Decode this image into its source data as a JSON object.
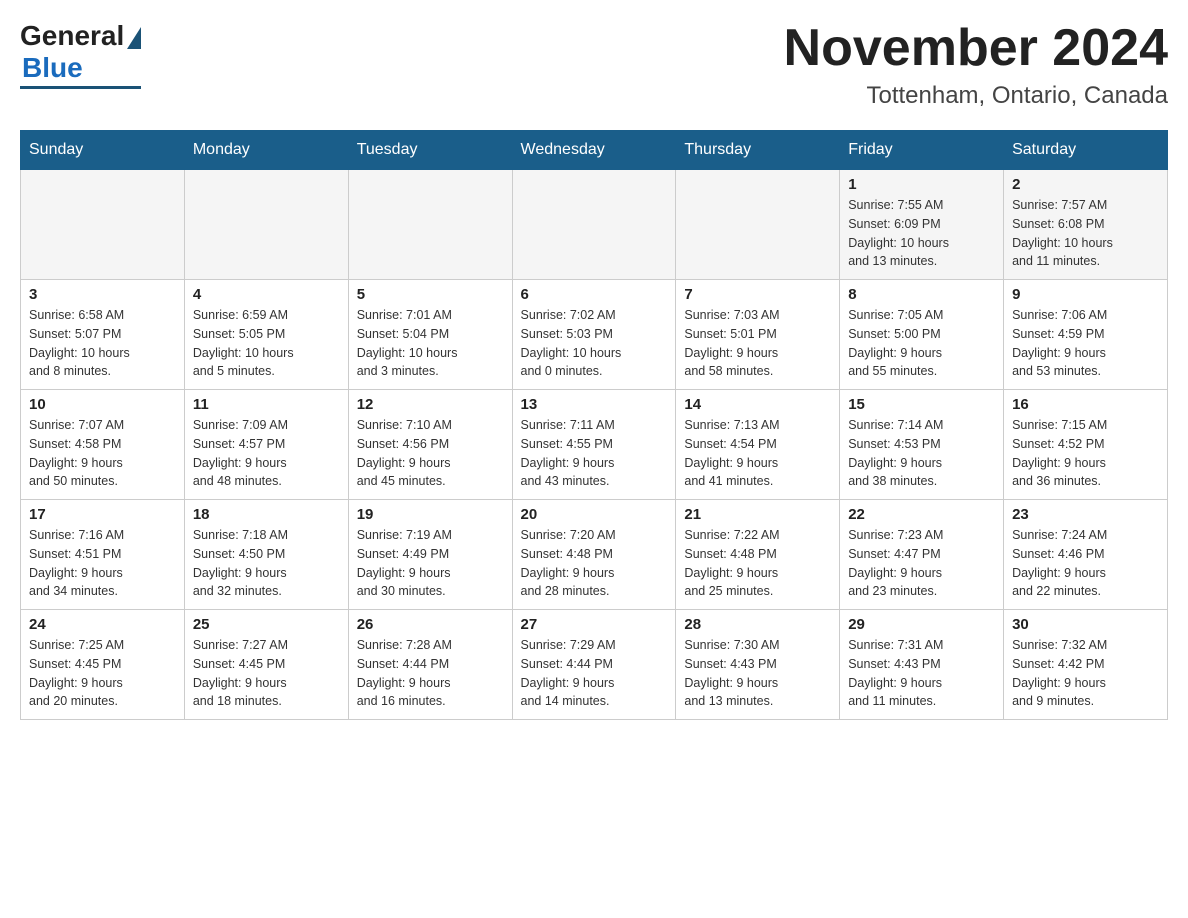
{
  "header": {
    "logo_general": "General",
    "logo_blue": "Blue",
    "month_title": "November 2024",
    "location": "Tottenham, Ontario, Canada"
  },
  "weekdays": [
    "Sunday",
    "Monday",
    "Tuesday",
    "Wednesday",
    "Thursday",
    "Friday",
    "Saturday"
  ],
  "weeks": [
    [
      {
        "day": "",
        "info": ""
      },
      {
        "day": "",
        "info": ""
      },
      {
        "day": "",
        "info": ""
      },
      {
        "day": "",
        "info": ""
      },
      {
        "day": "",
        "info": ""
      },
      {
        "day": "1",
        "info": "Sunrise: 7:55 AM\nSunset: 6:09 PM\nDaylight: 10 hours\nand 13 minutes."
      },
      {
        "day": "2",
        "info": "Sunrise: 7:57 AM\nSunset: 6:08 PM\nDaylight: 10 hours\nand 11 minutes."
      }
    ],
    [
      {
        "day": "3",
        "info": "Sunrise: 6:58 AM\nSunset: 5:07 PM\nDaylight: 10 hours\nand 8 minutes."
      },
      {
        "day": "4",
        "info": "Sunrise: 6:59 AM\nSunset: 5:05 PM\nDaylight: 10 hours\nand 5 minutes."
      },
      {
        "day": "5",
        "info": "Sunrise: 7:01 AM\nSunset: 5:04 PM\nDaylight: 10 hours\nand 3 minutes."
      },
      {
        "day": "6",
        "info": "Sunrise: 7:02 AM\nSunset: 5:03 PM\nDaylight: 10 hours\nand 0 minutes."
      },
      {
        "day": "7",
        "info": "Sunrise: 7:03 AM\nSunset: 5:01 PM\nDaylight: 9 hours\nand 58 minutes."
      },
      {
        "day": "8",
        "info": "Sunrise: 7:05 AM\nSunset: 5:00 PM\nDaylight: 9 hours\nand 55 minutes."
      },
      {
        "day": "9",
        "info": "Sunrise: 7:06 AM\nSunset: 4:59 PM\nDaylight: 9 hours\nand 53 minutes."
      }
    ],
    [
      {
        "day": "10",
        "info": "Sunrise: 7:07 AM\nSunset: 4:58 PM\nDaylight: 9 hours\nand 50 minutes."
      },
      {
        "day": "11",
        "info": "Sunrise: 7:09 AM\nSunset: 4:57 PM\nDaylight: 9 hours\nand 48 minutes."
      },
      {
        "day": "12",
        "info": "Sunrise: 7:10 AM\nSunset: 4:56 PM\nDaylight: 9 hours\nand 45 minutes."
      },
      {
        "day": "13",
        "info": "Sunrise: 7:11 AM\nSunset: 4:55 PM\nDaylight: 9 hours\nand 43 minutes."
      },
      {
        "day": "14",
        "info": "Sunrise: 7:13 AM\nSunset: 4:54 PM\nDaylight: 9 hours\nand 41 minutes."
      },
      {
        "day": "15",
        "info": "Sunrise: 7:14 AM\nSunset: 4:53 PM\nDaylight: 9 hours\nand 38 minutes."
      },
      {
        "day": "16",
        "info": "Sunrise: 7:15 AM\nSunset: 4:52 PM\nDaylight: 9 hours\nand 36 minutes."
      }
    ],
    [
      {
        "day": "17",
        "info": "Sunrise: 7:16 AM\nSunset: 4:51 PM\nDaylight: 9 hours\nand 34 minutes."
      },
      {
        "day": "18",
        "info": "Sunrise: 7:18 AM\nSunset: 4:50 PM\nDaylight: 9 hours\nand 32 minutes."
      },
      {
        "day": "19",
        "info": "Sunrise: 7:19 AM\nSunset: 4:49 PM\nDaylight: 9 hours\nand 30 minutes."
      },
      {
        "day": "20",
        "info": "Sunrise: 7:20 AM\nSunset: 4:48 PM\nDaylight: 9 hours\nand 28 minutes."
      },
      {
        "day": "21",
        "info": "Sunrise: 7:22 AM\nSunset: 4:48 PM\nDaylight: 9 hours\nand 25 minutes."
      },
      {
        "day": "22",
        "info": "Sunrise: 7:23 AM\nSunset: 4:47 PM\nDaylight: 9 hours\nand 23 minutes."
      },
      {
        "day": "23",
        "info": "Sunrise: 7:24 AM\nSunset: 4:46 PM\nDaylight: 9 hours\nand 22 minutes."
      }
    ],
    [
      {
        "day": "24",
        "info": "Sunrise: 7:25 AM\nSunset: 4:45 PM\nDaylight: 9 hours\nand 20 minutes."
      },
      {
        "day": "25",
        "info": "Sunrise: 7:27 AM\nSunset: 4:45 PM\nDaylight: 9 hours\nand 18 minutes."
      },
      {
        "day": "26",
        "info": "Sunrise: 7:28 AM\nSunset: 4:44 PM\nDaylight: 9 hours\nand 16 minutes."
      },
      {
        "day": "27",
        "info": "Sunrise: 7:29 AM\nSunset: 4:44 PM\nDaylight: 9 hours\nand 14 minutes."
      },
      {
        "day": "28",
        "info": "Sunrise: 7:30 AM\nSunset: 4:43 PM\nDaylight: 9 hours\nand 13 minutes."
      },
      {
        "day": "29",
        "info": "Sunrise: 7:31 AM\nSunset: 4:43 PM\nDaylight: 9 hours\nand 11 minutes."
      },
      {
        "day": "30",
        "info": "Sunrise: 7:32 AM\nSunset: 4:42 PM\nDaylight: 9 hours\nand 9 minutes."
      }
    ]
  ]
}
